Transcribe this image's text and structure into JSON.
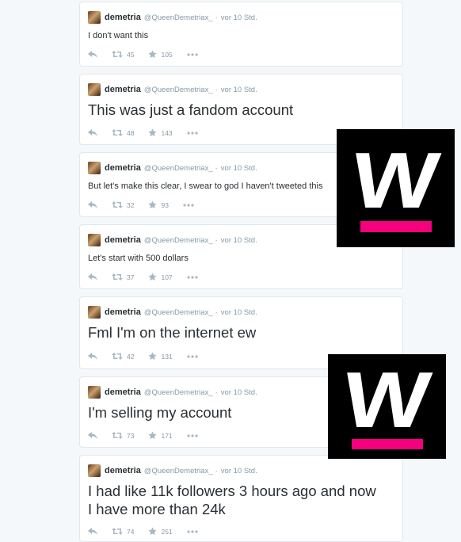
{
  "tweets": [
    {
      "name": "demetria",
      "handle": "@QueenDemetriax_",
      "sep": "·",
      "time": "vor 10 Std.",
      "text": "I don't want this",
      "retweets": "45",
      "favorites": "105",
      "size": "small"
    },
    {
      "name": "demetria",
      "handle": "@QueenDemetriax_",
      "sep": "·",
      "time": "vor 10 Std.",
      "text": "This was just a fandom account",
      "retweets": "48",
      "favorites": "143",
      "size": "large"
    },
    {
      "name": "demetria",
      "handle": "@QueenDemetriax_",
      "sep": "·",
      "time": "vor 10 Std.",
      "text": "But let's make this clear, I swear to god I haven't tweeted this",
      "retweets": "32",
      "favorites": "93",
      "size": "small"
    },
    {
      "name": "demetria",
      "handle": "@QueenDemetriax_",
      "sep": "·",
      "time": "vor 10 Std.",
      "text": "Let's start with 500 dollars",
      "retweets": "37",
      "favorites": "107",
      "size": "small"
    },
    {
      "name": "demetria",
      "handle": "@QueenDemetriax_",
      "sep": "·",
      "time": "vor 10 Std.",
      "text": "Fml I'm on the internet ew",
      "retweets": "42",
      "favorites": "131",
      "size": "large"
    },
    {
      "name": "demetria",
      "handle": "@QueenDemetriax_",
      "sep": "·",
      "time": "vor 10 Std.",
      "text": "I'm selling my account",
      "retweets": "73",
      "favorites": "171",
      "size": "large"
    },
    {
      "name": "demetria",
      "handle": "@QueenDemetriax_",
      "sep": "·",
      "time": "vor 10 Std.",
      "text_line1": "I had like 11k followers 3 hours ago and now",
      "text_line2": "I have more than 24k",
      "retweets": "74",
      "favorites": "251",
      "size": "large"
    }
  ],
  "watermark": {
    "letter": "W",
    "bg_color": "#000000",
    "accent_color": "#f5007d"
  },
  "icons": {
    "reply": "reply-icon",
    "retweet": "retweet-icon",
    "favorite": "star-icon",
    "more": "more-dots-icon"
  }
}
